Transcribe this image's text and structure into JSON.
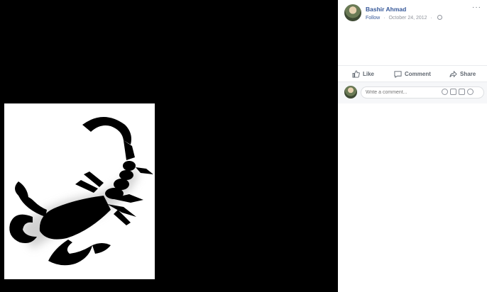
{
  "post": {
    "author": "Bashir Ahmad",
    "follow_label": "Follow",
    "separator": "·",
    "date": "October 24, 2012",
    "more_label": "···"
  },
  "actions": {
    "like_label": "Like",
    "comment_label": "Comment",
    "share_label": "Share"
  },
  "comment_box": {
    "placeholder": "Write a comment..."
  },
  "icons": {
    "like": "thumbs-up-icon",
    "comment": "speech-bubble-icon",
    "share": "share-arrow-icon",
    "globe": "globe-icon",
    "emoji": "emoji-icon",
    "camera": "camera-icon",
    "gif": "gif-icon",
    "sticker": "sticker-icon"
  },
  "colors": {
    "link": "#365899",
    "muted": "#90949c",
    "stage_bg": "#000000",
    "panel_bg": "#ffffff"
  }
}
